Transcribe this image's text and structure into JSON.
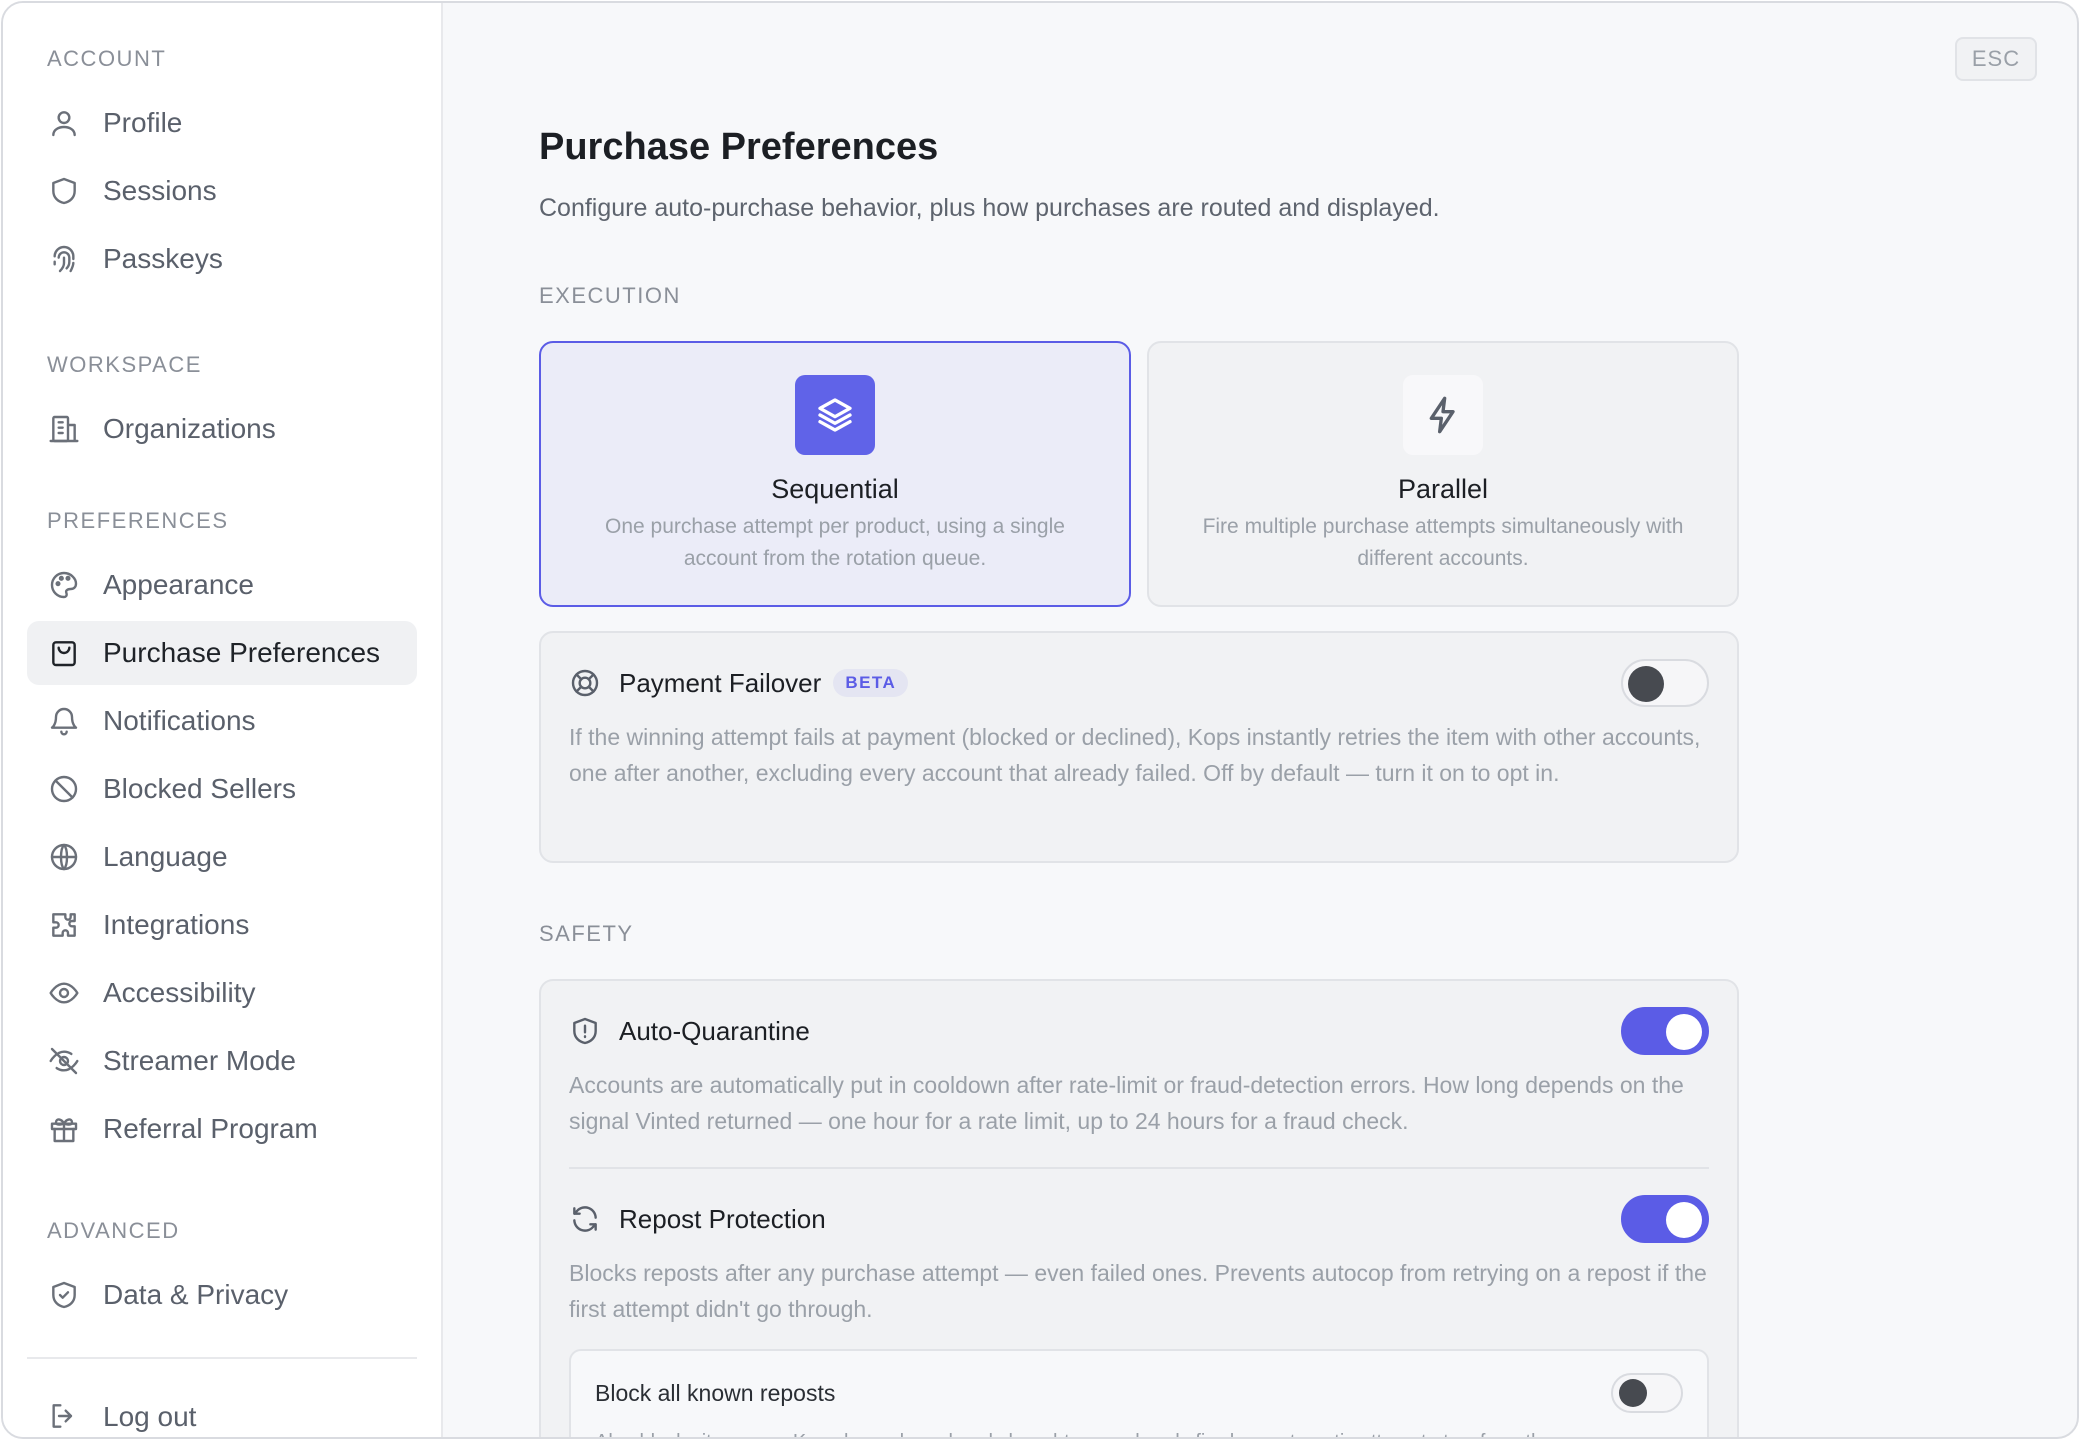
{
  "sidebar": {
    "groups": [
      {
        "label": "ACCOUNT",
        "items": [
          {
            "label": "Profile",
            "icon": "user-icon"
          },
          {
            "label": "Sessions",
            "icon": "shield-icon"
          },
          {
            "label": "Passkeys",
            "icon": "fingerprint-icon"
          }
        ]
      },
      {
        "label": "WORKSPACE",
        "items": [
          {
            "label": "Organizations",
            "icon": "building-icon"
          }
        ]
      },
      {
        "label": "PREFERENCES",
        "items": [
          {
            "label": "Appearance",
            "icon": "palette-icon"
          },
          {
            "label": "Purchase Preferences",
            "icon": "shopping-bag-icon",
            "active": true
          },
          {
            "label": "Notifications",
            "icon": "bell-icon"
          },
          {
            "label": "Blocked Sellers",
            "icon": "ban-icon"
          },
          {
            "label": "Language",
            "icon": "globe-icon"
          },
          {
            "label": "Integrations",
            "icon": "puzzle-icon"
          },
          {
            "label": "Accessibility",
            "icon": "eye-icon"
          },
          {
            "label": "Streamer Mode",
            "icon": "eye-off-icon"
          },
          {
            "label": "Referral Program",
            "icon": "gift-icon"
          }
        ]
      },
      {
        "label": "ADVANCED",
        "items": [
          {
            "label": "Data & Privacy",
            "icon": "shield-check-icon"
          }
        ]
      }
    ],
    "logout_label": "Log out"
  },
  "header": {
    "esc_label": "ESC",
    "title": "Purchase Preferences",
    "subtitle": "Configure auto-purchase behavior, plus how purchases are routed and displayed."
  },
  "execution": {
    "section_label": "EXECUTION",
    "modes": [
      {
        "name": "Sequential",
        "description": "One purchase attempt per product, using a single account from the rotation queue.",
        "icon": "layers-icon",
        "selected": true
      },
      {
        "name": "Parallel",
        "description": "Fire multiple purchase attempts simultaneously with different accounts.",
        "icon": "zap-icon",
        "selected": false
      }
    ],
    "failover": {
      "title": "Payment Failover",
      "badge": "BETA",
      "icon": "lifebuoy-icon",
      "enabled": false,
      "description": "If the winning attempt fails at payment (blocked or declined), Kops instantly retries the item with other accounts, one after another, excluding every account that already failed. Off by default — turn it on to opt in."
    }
  },
  "safety": {
    "section_label": "SAFETY",
    "auto_quarantine": {
      "title": "Auto-Quarantine",
      "icon": "shield-alert-icon",
      "enabled": true,
      "description": "Accounts are automatically put in cooldown after rate-limit or fraud-detection errors. How long depends on the signal Vinted returned — one hour for a rate limit, up to 24 hours for a fraud check."
    },
    "repost_protection": {
      "title": "Repost Protection",
      "icon": "refresh-icon",
      "enabled": true,
      "description": "Blocks reposts after any purchase attempt — even failed ones. Prevents autocop from retrying on a repost if the first attempt didn't go through.",
      "sub_option": {
        "title": "Block all known reposts",
        "enabled": false,
        "description": "Also blocks items any Kops buyer has already bought — or already fired an automatic attempt at — from the"
      }
    }
  },
  "colors": {
    "accent": "#5b5ce6",
    "selected_card_bg": "#ebecf8",
    "toggle_off_knob": "#474a50"
  }
}
